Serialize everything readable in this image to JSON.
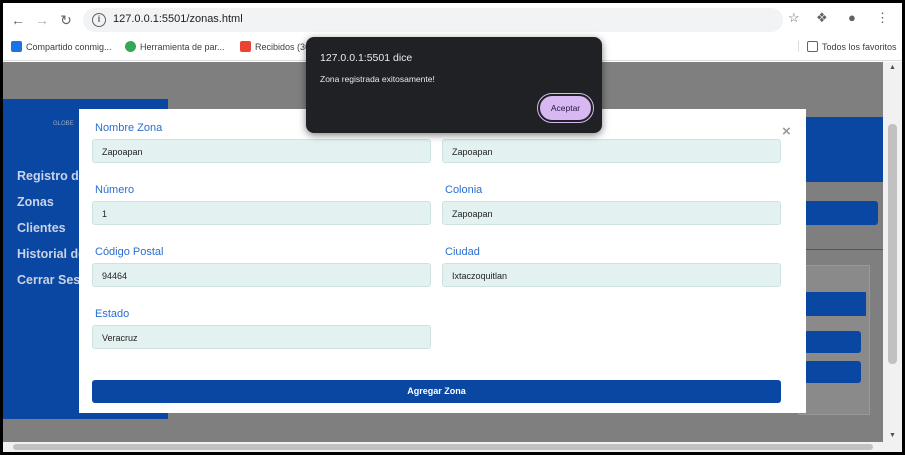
{
  "browser": {
    "url": "127.0.0.1:5501/zonas.html",
    "bookmarks": [
      {
        "label": "Compartido conmig...",
        "color": "#1a73e8"
      },
      {
        "label": "Herramienta de par...",
        "color": "#34a853"
      },
      {
        "label": "Recibidos (36) - 202...",
        "color": "#ea4335"
      }
    ],
    "all_bookmarks": "Todos los favoritos"
  },
  "sidebar": {
    "logo": "GLOBE",
    "items": [
      "Registro de",
      "Zonas",
      "Clientes",
      "Historial de",
      "Cerrar Ses"
    ]
  },
  "form": {
    "fields": [
      {
        "label": "Nombre Zona",
        "value": "Zapoapan"
      },
      {
        "label": "",
        "value": "Zapoapan"
      },
      {
        "label": "Número",
        "value": "1"
      },
      {
        "label": "Colonia",
        "value": "Zapoapan"
      },
      {
        "label": "Código Postal",
        "value": "94464"
      },
      {
        "label": "Ciudad",
        "value": "Ixtaczoquitlan"
      },
      {
        "label": "Estado",
        "value": "Veracruz"
      }
    ],
    "submit_label": "Agregar Zona",
    "close_symbol": "×"
  },
  "alert": {
    "title": "127.0.0.1:5501 dice",
    "message": "Zona registrada exitosamente!",
    "button": "Aceptar"
  },
  "colors": {
    "primary": "#0a47a3",
    "label": "#2a6ed1",
    "input_bg": "#e3f2f1",
    "alert_bg": "#202124",
    "alert_button": "#d7b8f3"
  }
}
